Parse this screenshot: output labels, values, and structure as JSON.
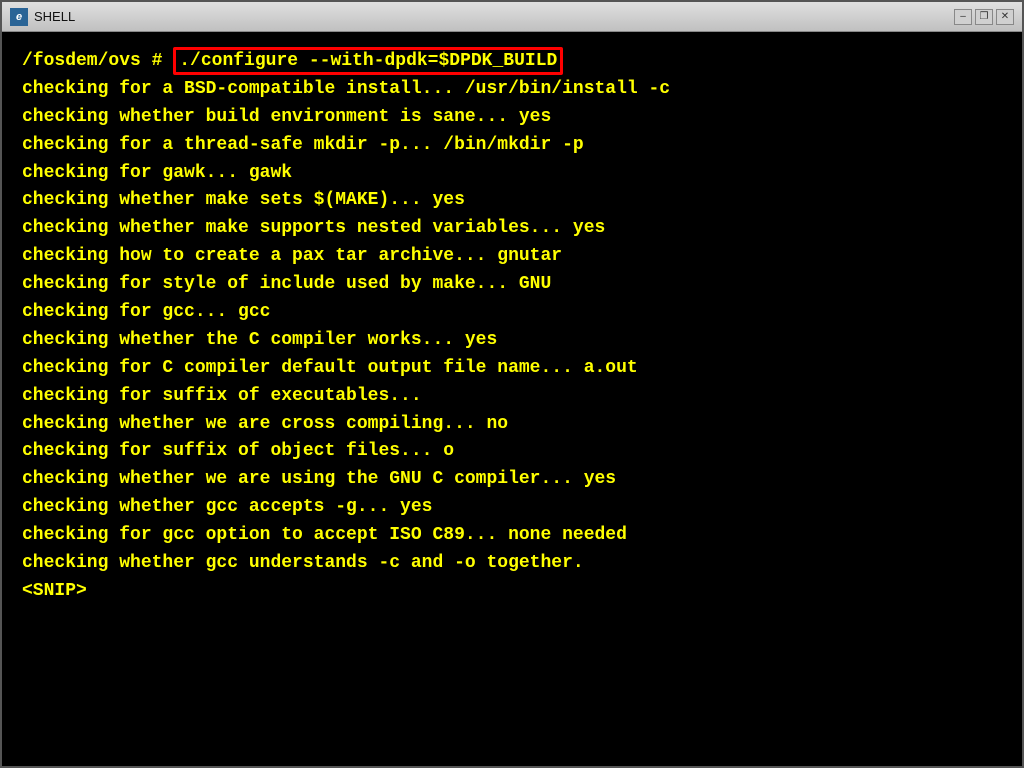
{
  "window": {
    "title": "SHELL",
    "icon": "e"
  },
  "titlebar": {
    "minimize_label": "–",
    "restore_label": "❐",
    "close_label": "✕"
  },
  "terminal": {
    "lines": [
      {
        "id": "cmd",
        "prompt": "/fosdem/ovs # ",
        "command": "./configure --with-dpdk=$DPDK_BUILD",
        "highlighted": true
      },
      {
        "id": "l1",
        "text": "checking for a BSD-compatible install... /usr/bin/install -c"
      },
      {
        "id": "l2",
        "text": "checking whether build environment is sane... yes"
      },
      {
        "id": "l3",
        "text": "checking for a thread-safe mkdir -p... /bin/mkdir -p"
      },
      {
        "id": "l4",
        "text": "checking for gawk... gawk"
      },
      {
        "id": "l5",
        "text": "checking whether make sets $(MAKE)... yes"
      },
      {
        "id": "l6",
        "text": "checking whether make supports nested variables... yes"
      },
      {
        "id": "l7",
        "text": "checking how to create a pax tar archive... gnutar"
      },
      {
        "id": "l8",
        "text": "checking for style of include used by make... GNU"
      },
      {
        "id": "l9",
        "text": "checking for gcc... gcc"
      },
      {
        "id": "l10",
        "text": "checking whether the C compiler works... yes"
      },
      {
        "id": "l11",
        "text": "checking for C compiler default output file name... a.out"
      },
      {
        "id": "l12",
        "text": "checking for suffix of executables..."
      },
      {
        "id": "l13",
        "text": "checking whether we are cross compiling... no"
      },
      {
        "id": "l14",
        "text": "checking for suffix of object files... o"
      },
      {
        "id": "l15",
        "text": "checking whether we are using the GNU C compiler... yes"
      },
      {
        "id": "l16",
        "text": "checking whether gcc accepts -g... yes"
      },
      {
        "id": "l17",
        "text": "checking for gcc option to accept ISO C89... none needed"
      },
      {
        "id": "l18",
        "text": "checking whether gcc understands -c and -o together."
      },
      {
        "id": "l19",
        "text": "<SNIP>"
      }
    ]
  }
}
